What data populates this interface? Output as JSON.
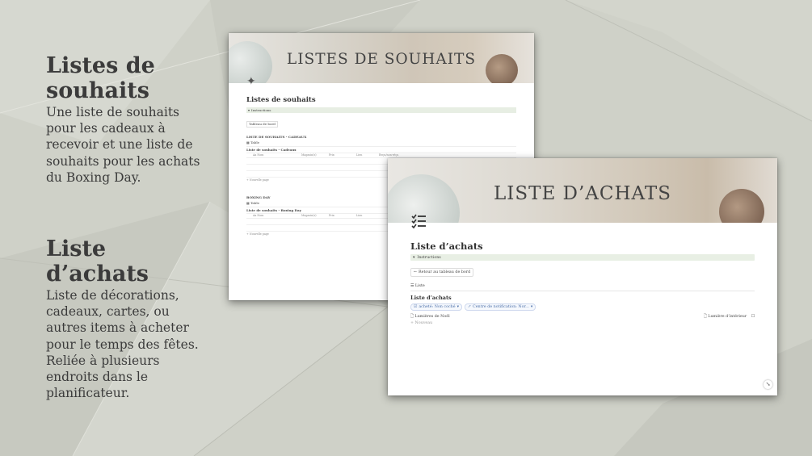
{
  "side": {
    "section1": {
      "title": "Listes de souhaits",
      "text": "Une liste de souhaits pour les cadeaux à recevoir et une liste de souhaits pour les achats du Boxing Day."
    },
    "section2": {
      "title": "Liste d’achats",
      "text": "Liste de décorations, cadeaux, cartes, ou autres items à acheter pour le temps des fêtes. Reliée à plusieurs endroits dans le planificateur."
    }
  },
  "window1": {
    "banner_title": "LISTES DE SOUHAITS",
    "page_title": "Listes de souhaits",
    "instructions_label": "Instructions",
    "dashboard_button": "Tableau de bord",
    "section1": {
      "heading": "LISTE DE SOUHAITS - CADEAUX",
      "view_tab": "Table",
      "db_title": "Liste de souhaits - Cadeaux",
      "columns": [
        "Aa Nom",
        "Magasin(s)",
        "Prix",
        "Lien",
        "Reçu/non-réçu"
      ],
      "new_page": "+ Nouvelle page"
    },
    "section2": {
      "heading": "BOXING DAY",
      "view_tab": "Table",
      "db_title": "Liste de souhaits - Boxing Day",
      "columns": [
        "Aa Nom",
        "Magasin(s)",
        "Prix",
        "Lien"
      ],
      "new_page": "+ Nouvelle page"
    }
  },
  "window2": {
    "banner_title": "LISTE D’ACHATS",
    "page_title": "Liste d’achats",
    "instructions_label": "Instructions",
    "back_button": "Retour au tableau de bord",
    "view_tab": "Liste",
    "db_title": "Liste d’achats",
    "filters": [
      "acheté: Non coché",
      "Centre de notification: Nor..."
    ],
    "row": {
      "name": "Lumières de Noël",
      "tag": "Lumière d’intérieur"
    },
    "new_item": "+ Nouveau"
  }
}
